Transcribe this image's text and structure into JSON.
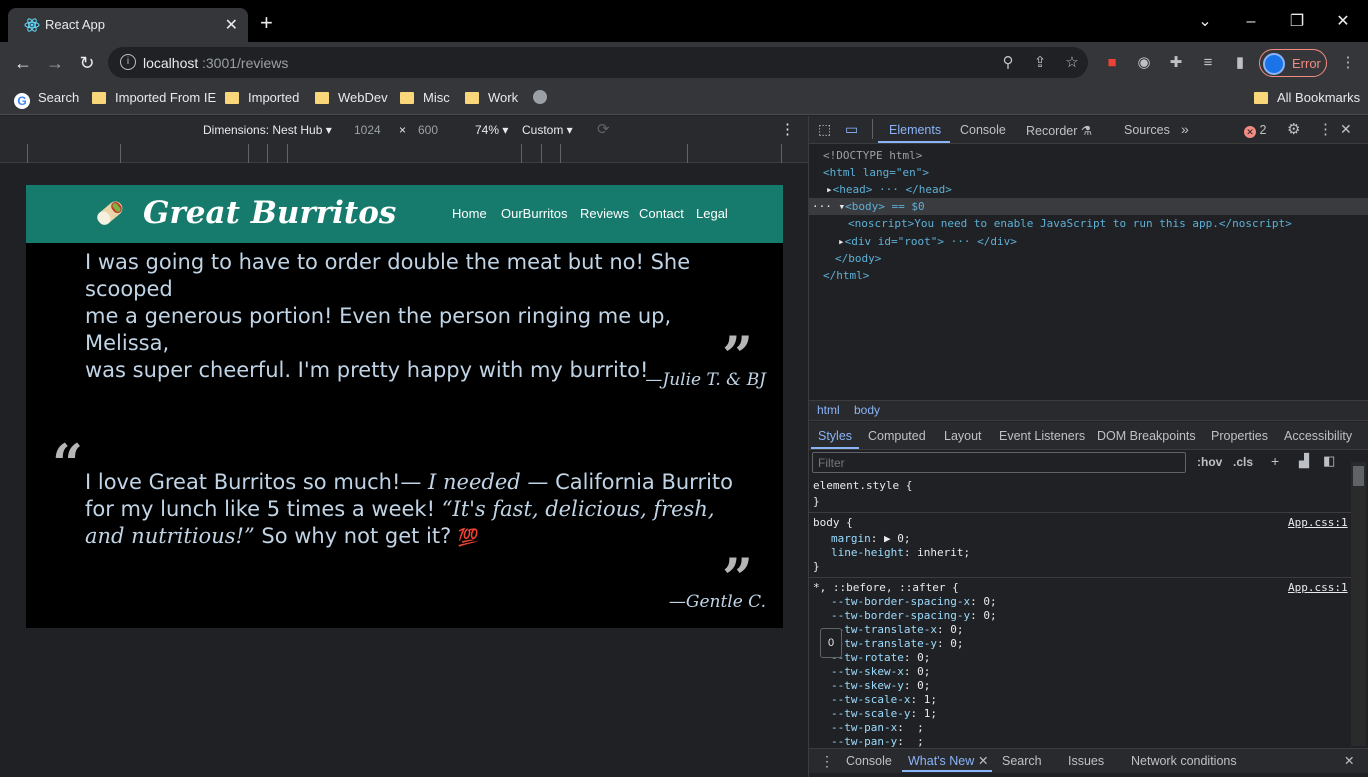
{
  "browser": {
    "tab_title": "React App",
    "new_tab": "+",
    "url_host": "localhost",
    "url_path": ":3001/reviews",
    "profile_label": "Error",
    "bookmarks": [
      "Search",
      "Imported From IE",
      "Imported",
      "WebDev",
      "Misc",
      "Work"
    ],
    "all_bookmarks": "All Bookmarks"
  },
  "device_toolbar": {
    "dimensions": "Dimensions: Nest Hub",
    "width": "1024",
    "times": "×",
    "height": "600",
    "zoom": "74%",
    "throttle": "Custom"
  },
  "site": {
    "brand": "Great Burritos",
    "nav": [
      "Home",
      "OurBurritos",
      "Reviews",
      "Contact",
      "Legal"
    ],
    "review1": {
      "text_lines": [
        "I was going to have to order double the meat but no! She scooped",
        "me a generous portion! Even the person ringing me up, Melissa,",
        "was super cheerful. I'm pretty happy with my burrito!"
      ],
      "author": "—Julie T. & BJ"
    },
    "review2": {
      "part1": "I love Great Burritos so much!— ",
      "part2_italic": "I needed",
      "part3": " — California Burrito for my lunch like 5 times a week! ",
      "part4_italic": "“It's fast, delicious, fresh, and nutritious!”",
      "part5": " So why not get it? ",
      "emoji": "💯",
      "author": "—Gentle C."
    },
    "quote_open": "“",
    "quote_close": "”"
  },
  "devtools": {
    "tabs": [
      "Elements",
      "Console",
      "Recorder",
      "Sources"
    ],
    "error_count": "2",
    "dom_lines": {
      "doctype": "<!DOCTYPE html>",
      "html_open": "<html lang=\"en\">",
      "head": "<head> ··· </head>",
      "body": "<body> == $0",
      "noscript": "<noscript>You need to enable JavaScript to run this app.</noscript>",
      "root": "<div id=\"root\"> ··· </div>",
      "body_close": "</body>",
      "html_close": "</html>"
    },
    "crumbs": [
      "html",
      "body"
    ],
    "style_tabs": [
      "Styles",
      "Computed",
      "Layout",
      "Event Listeners",
      "DOM Breakpoints",
      "Properties",
      "Accessibility"
    ],
    "filter_placeholder": "Filter",
    "hov": ":hov",
    "cls": ".cls",
    "rules": {
      "element_style": "element.style {",
      "close": "}",
      "body_sel": "body {",
      "body_src": "App.css:1",
      "body_props": [
        [
          "margin",
          "▶ 0;"
        ],
        [
          "line-height",
          "inherit;"
        ]
      ],
      "univ_sel": "*, ::before, ::after {",
      "univ_src": "App.css:1",
      "univ_props": [
        [
          "--tw-border-spacing-x",
          "0;"
        ],
        [
          "--tw-border-spacing-y",
          "0;"
        ],
        [
          "--tw-translate-x",
          "0;"
        ],
        [
          "--tw-translate-y",
          "0;"
        ],
        [
          "--tw-rotate",
          "0;"
        ],
        [
          "--tw-skew-x",
          "0;"
        ],
        [
          "--tw-skew-y",
          "0;"
        ],
        [
          "--tw-scale-x",
          "1;"
        ],
        [
          "--tw-scale-y",
          "1;"
        ],
        [
          "--tw-pan-x",
          " ;"
        ],
        [
          "--tw-pan-y",
          " ;"
        ]
      ]
    },
    "tooltip": "0",
    "bottom_tabs": [
      "Console",
      "What's New",
      "Search",
      "Issues",
      "Network conditions"
    ]
  }
}
